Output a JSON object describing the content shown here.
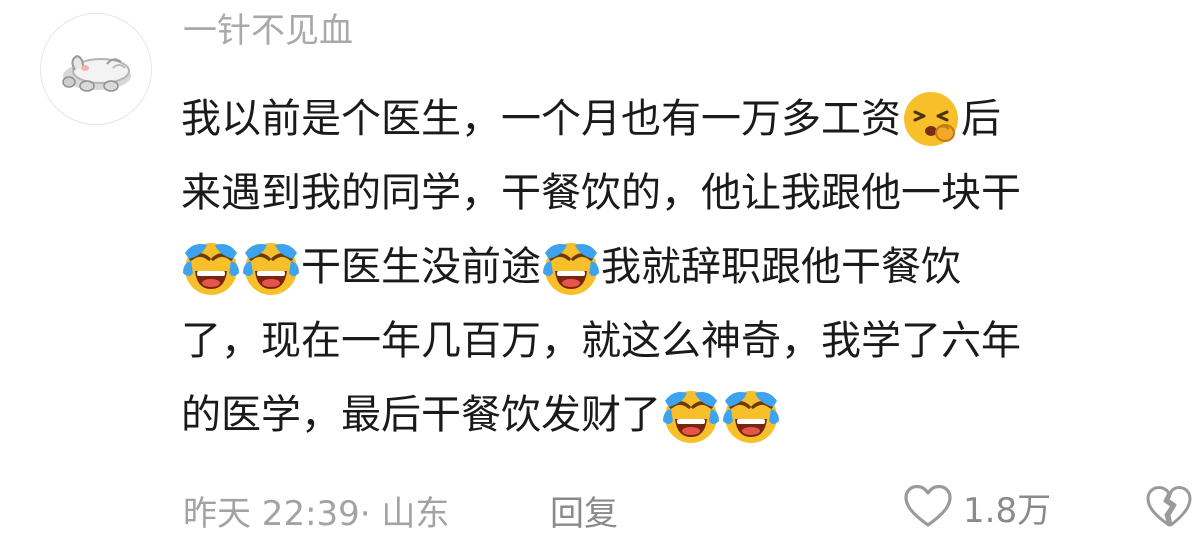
{
  "comment": {
    "username": "一针不见血",
    "lines": [
      [
        {
          "text": "我以前是个医生，一个月也有一万多工资"
        },
        {
          "emoji": "tired-face-emoji"
        },
        {
          "text": "后"
        }
      ],
      [
        {
          "text": "来遇到我的同学，干餐饮的，他让我跟他一块干"
        }
      ],
      [
        {
          "emoji": "crying-laughing-emoji"
        },
        {
          "emoji": "crying-laughing-emoji"
        },
        {
          "text": "干医生没前途"
        },
        {
          "emoji": "crying-laughing-emoji"
        },
        {
          "text": "我就辞职跟他干餐饮"
        }
      ],
      [
        {
          "text": "了，现在一年几百万，就这么神奇，我学了六年"
        }
      ],
      [
        {
          "text": "的医学，最后干餐饮发财了"
        },
        {
          "emoji": "crying-laughing-emoji"
        },
        {
          "emoji": "crying-laughing-emoji"
        }
      ]
    ],
    "meta": "昨天 22:39· 山东",
    "reply_label": "回复",
    "like_count": "1.8万"
  },
  "colors": {
    "text": "#1a1a1a",
    "muted": "#a3a3a3",
    "emoji_yellow": "#f7c02b"
  },
  "icons": {
    "like": "heart-outline-icon",
    "dislike": "broken-heart-icon",
    "avatar": "cat-avatar"
  }
}
